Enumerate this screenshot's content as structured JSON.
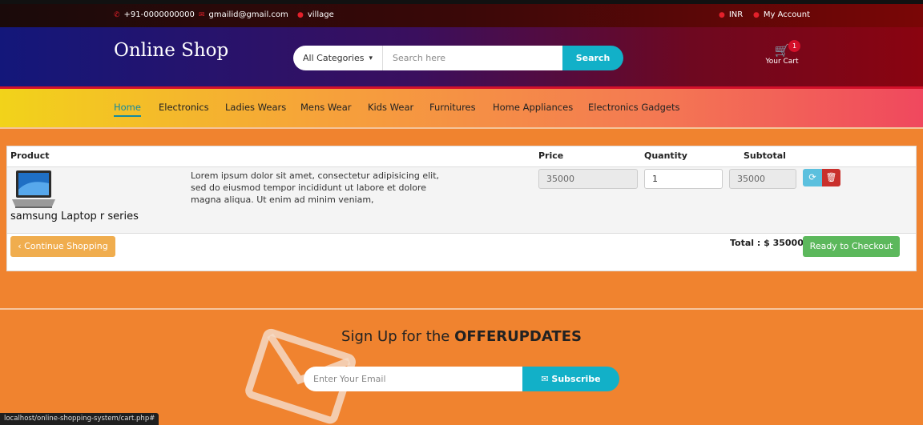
{
  "topbar": {
    "phone": "+91-0000000000",
    "email": "gmailid@gmail.com",
    "location": "village",
    "currency": "INR",
    "account": "My Account"
  },
  "header": {
    "logo": "Online Shop",
    "category": "All Categories",
    "search_placeholder": "Search here",
    "search_button": "Search",
    "cart_label": "Your Cart",
    "cart_count": "1"
  },
  "nav": {
    "items": [
      "Home",
      "Electronics",
      "Ladies Wears",
      "Mens Wear",
      "Kids Wear",
      "Furnitures",
      "Home Appliances",
      "Electronics Gadgets"
    ]
  },
  "cart": {
    "headers": {
      "product": "Product",
      "price": "Price",
      "quantity": "Quantity",
      "subtotal": "Subtotal"
    },
    "item": {
      "name": "samsung Laptop r series",
      "description": "Lorem ipsum dolor sit amet, consectetur adipisicing elit, sed do eiusmod tempor incididunt ut labore et dolore magna aliqua. Ut enim ad minim veniam,",
      "price": "35000",
      "quantity": "1",
      "subtotal": "35000"
    },
    "continue": "‹ Continue Shopping",
    "total": "Total : $ 35000",
    "checkout": "Ready to Checkout"
  },
  "newsletter": {
    "title_prefix": "Sign Up for the ",
    "title_bold": "OFFERUPDATES",
    "placeholder": "Enter Your Email",
    "button": "Subscribe"
  },
  "status_url": "localhost/online-shopping-system/cart.php#",
  "colors": {
    "accent": "#12b0c8",
    "brand_red": "#d4102a",
    "warning": "#f0ad4e",
    "success": "#5cb85c",
    "danger": "#c9302c",
    "info": "#5bc0de"
  }
}
